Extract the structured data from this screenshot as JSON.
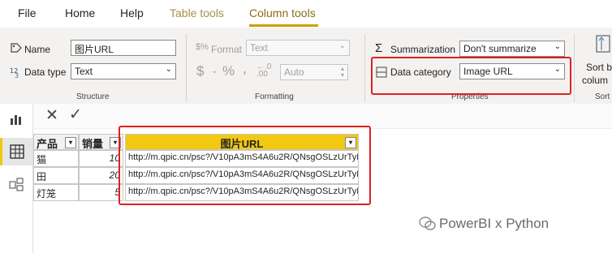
{
  "menu_tabs": [
    "File",
    "Home",
    "Help",
    "Table tools",
    "Column tools"
  ],
  "structure": {
    "name_label": "Name",
    "name_value": "图片URL",
    "datatype_label": "Data type",
    "datatype_value": "Text",
    "group_label": "Structure"
  },
  "formatting": {
    "format_label": "Format",
    "format_value": "Text",
    "currency_symbol": "$",
    "percent_symbol": "%",
    "comma_symbol": ",",
    "auto_value": "Auto",
    "group_label": "Formatting"
  },
  "properties": {
    "summarization_label": "Summarization",
    "summarization_value": "Don't summarize",
    "datacategory_label": "Data category",
    "datacategory_value": "Image URL",
    "group_label": "Properties"
  },
  "sort": {
    "sort_by_line1": "Sort b",
    "sort_by_line2": "colum",
    "group_label": "Sort"
  },
  "table": {
    "columns": [
      "产品",
      "销量",
      "图片URL"
    ],
    "rows": [
      {
        "product": "猫",
        "sales": "10",
        "url": "http://m.qpic.cn/psc?/V10pA3mS4A6u2R/QNsgOSLzUrTyE"
      },
      {
        "product": "田",
        "sales": "20",
        "url": "http://m.qpic.cn/psc?/V10pA3mS4A6u2R/QNsgOSLzUrTyE"
      },
      {
        "product": "灯笼",
        "sales": "5",
        "url": "http://m.qpic.cn/psc?/V10pA3mS4A6u2R/QNsgOSLzUrTyE"
      }
    ]
  },
  "watermark": "PowerBI x Python",
  "colors": {
    "accent": "#f2c811",
    "highlight": "#e02020"
  }
}
